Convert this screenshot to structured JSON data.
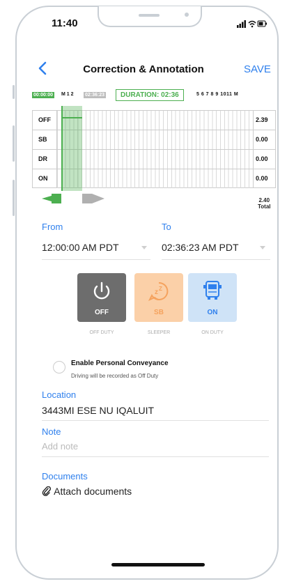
{
  "status_bar": {
    "time": "11:40"
  },
  "header": {
    "title": "Correction & Annotation",
    "save_label": "SAVE",
    "back_icon": "chevron-left-icon"
  },
  "timeline": {
    "start_time": "00:00:00",
    "hour_labels_left": "M 1  2",
    "end_time": "02:36:23",
    "duration_label": "DURATION: 02:36",
    "hour_labels_right": "5 6 7 8 9 1011 M"
  },
  "log_grid": {
    "rows": [
      {
        "label": "OFF",
        "value": "2.39"
      },
      {
        "label": "SB",
        "value": "0.00"
      },
      {
        "label": "DR",
        "value": "0.00"
      },
      {
        "label": "ON",
        "value": "0.00"
      }
    ],
    "total_value": "2.40",
    "total_label": "Total",
    "selection": {
      "start_fraction": 0.0,
      "end_fraction": 0.109
    }
  },
  "time_range": {
    "from_label": "From",
    "from_value": "12:00:00 AM PDT",
    "to_label": "To",
    "to_value": "02:36:23 AM PDT"
  },
  "duty_status": {
    "options": [
      {
        "code": "OFF",
        "caption": "OFF DUTY",
        "icon": "power-icon",
        "color": "#6d6d6d",
        "selected": true
      },
      {
        "code": "SB",
        "caption": "SLEEPER",
        "icon": "sleep-icon",
        "color": "#f5a25d",
        "selected": false
      },
      {
        "code": "ON",
        "caption": "ON DUTY",
        "icon": "truck-icon",
        "color": "#2f80ed",
        "selected": false
      }
    ]
  },
  "personal_conveyance": {
    "title": "Enable Personal Conveyance",
    "subtitle": "Driving will be recorded as Off Duty"
  },
  "location": {
    "label": "Location",
    "value": "3443MI ESE NU IQALUIT"
  },
  "note": {
    "label": "Note",
    "placeholder": "Add note"
  },
  "documents": {
    "label": "Documents",
    "attach_label": "Attach documents",
    "attach_icon": "paperclip-icon"
  },
  "colors": {
    "accent": "#2f80ed",
    "selection_green": "#4caf50"
  }
}
